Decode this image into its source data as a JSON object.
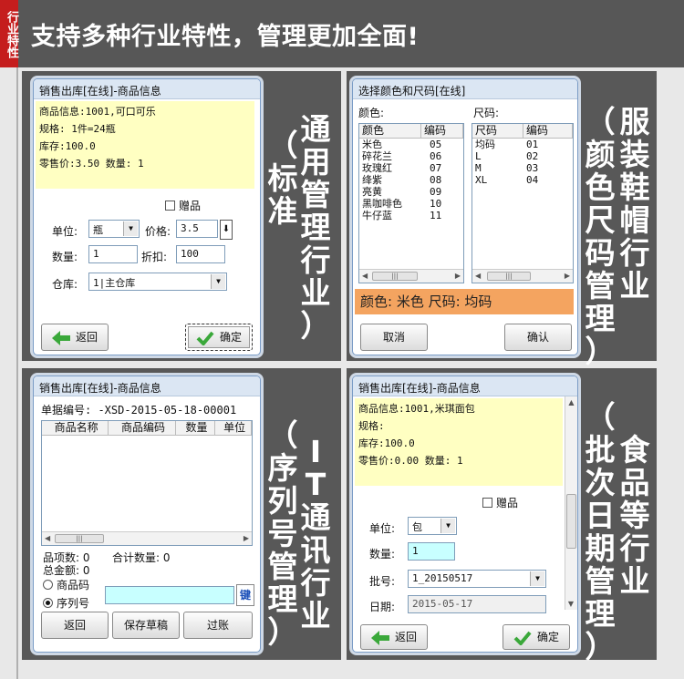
{
  "header": {
    "side_tab": "行业特性",
    "title": "支持多种行业特性，管理更加全面!"
  },
  "panel_labels": {
    "standard": [
      "（标准",
      "通用管理行业）"
    ],
    "apparel": [
      "（颜色尺码管理）",
      "服装鞋帽行业"
    ],
    "it": [
      "（序列号管理）",
      "IT通讯行业"
    ],
    "food": [
      "（批次日期管理）",
      "食品等行业"
    ]
  },
  "win1": {
    "title": "销售出库[在线]-商品信息",
    "info_lines": [
      "商品信息:1001,可口可乐",
      "规格:  1件=24瓶",
      "库存:100.0",
      "零售价:3.50 数量: 1"
    ],
    "gift_label": "赠品",
    "unit_label": "单位:",
    "unit_value": "瓶",
    "price_label": "价格:",
    "price_value": "3.5",
    "qty_label": "数量:",
    "qty_value": "1",
    "discount_label": "折扣:",
    "discount_value": "100",
    "warehouse_label": "仓库:",
    "warehouse_value": "1|主仓库",
    "back_label": "返回",
    "ok_label": "确定"
  },
  "win2": {
    "title": "选择颜色和尺码[在线]",
    "color_label": "颜色:",
    "size_label": "尺码:",
    "color_headers": [
      "颜色",
      "编码"
    ],
    "colors": [
      [
        "米色",
        "05"
      ],
      [
        "碎花兰",
        "06"
      ],
      [
        "玫瑰红",
        "07"
      ],
      [
        "绛紫",
        "08"
      ],
      [
        "亮黄",
        "09"
      ],
      [
        "黑咖啡色",
        "10"
      ],
      [
        "牛仔蓝",
        "11"
      ]
    ],
    "size_headers": [
      "尺码",
      "编码"
    ],
    "sizes": [
      [
        "均码",
        "01"
      ],
      [
        "L",
        "02"
      ],
      [
        "M",
        "03"
      ],
      [
        "XL",
        "04"
      ]
    ],
    "selection_text": "颜色: 米色  尺码: 均码",
    "selection_color": "#f4a460",
    "cancel_label": "取消",
    "confirm_label": "确认"
  },
  "win3": {
    "title": "销售出库[在线]-商品信息",
    "doc_no": "单据编号:   -XSD-2015-05-18-00001",
    "table_headers": [
      "商品名称",
      "商品编码",
      "数量",
      "单位"
    ],
    "item_count": "品项数: 0",
    "total_qty": "合计数量: 0",
    "total_amount": "总金额: 0",
    "radio_product_code": "商品码",
    "radio_serial": "序列号",
    "key_label": "键",
    "back_label": "返回",
    "save_draft_label": "保存草稿",
    "post_label": "过账"
  },
  "win4": {
    "title": "销售出库[在线]-商品信息",
    "info_lines": [
      "商品信息:1001,米琪面包",
      "规格:",
      "库存:100.0",
      "零售价:0.00 数量: 1"
    ],
    "gift_label": "赠品",
    "unit_label": "单位:",
    "unit_value": "包",
    "qty_label": "数量:",
    "qty_value": "1",
    "batch_label": "批号:",
    "batch_value": "1_20150517",
    "date_label": "日期:",
    "date_value": "2015-05-17",
    "back_label": "返回",
    "ok_label": "确定"
  },
  "colors": {
    "header_bg": "#575757",
    "side_tab": "#c51d1d",
    "panel_bg": "#585858",
    "info_yellow": "#ffffc2",
    "input_cyan": "#c8ffff"
  }
}
